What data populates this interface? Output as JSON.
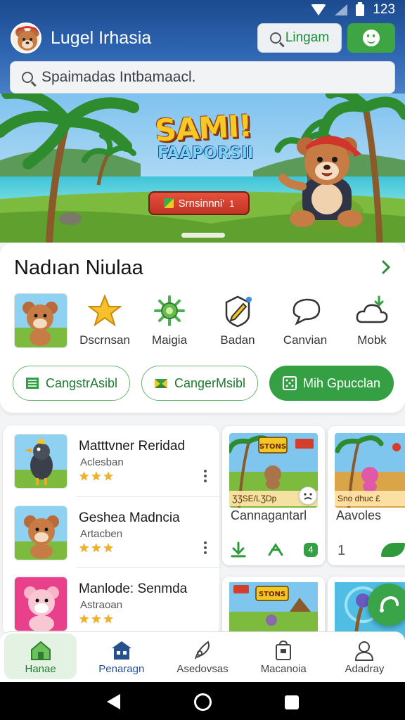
{
  "status_bar": {
    "time": "123"
  },
  "header": {
    "app_title": "Lugel Irhasia",
    "language_button_label": "Lingam",
    "search_placeholder": "Spaimadas Intbamaacl."
  },
  "banner": {
    "title_line1": "SAMI!",
    "title_line2": "FAAPORSII",
    "button_label": "Srnsinnni'",
    "button_badge": "1"
  },
  "featured": {
    "title": "Nadıan Niulaa",
    "categories": [
      {
        "label": "Dscrnsan",
        "icon": "star-icon"
      },
      {
        "label": "Maigia",
        "icon": "gear-sun-icon"
      },
      {
        "label": "Badan",
        "icon": "pen-badge-icon"
      },
      {
        "label": "Canvian",
        "icon": "speech-bubble-icon"
      },
      {
        "label": "Mobk",
        "icon": "cloud-download-icon"
      }
    ],
    "pills": [
      {
        "label": "CangstrAsibl",
        "icon": "list-icon"
      },
      {
        "label": "CangerMsibl",
        "icon": "envelope-icon"
      },
      {
        "label": "Mih Gpucclan",
        "icon": "grid-icon"
      }
    ]
  },
  "list": [
    {
      "title": "Matttvner Reridad",
      "subtitle": "Aclesban",
      "stars": "★★★",
      "rating_stars": 3
    },
    {
      "title": "Geshea Madncia",
      "subtitle": "Artacben",
      "stars": "★★★",
      "rating_stars": 3
    },
    {
      "title": "Manlode: Senmda",
      "subtitle": "Astraoan",
      "stars": "★★★",
      "rating_stars": 3
    }
  ],
  "games": [
    {
      "title": "Cannagantarl",
      "strip": "ƷƷSE/LƷDp",
      "badge": "4",
      "thumb_label": "STONS"
    },
    {
      "title": "Aavoles",
      "strip": "Sno dhuc £",
      "badge": "1"
    }
  ],
  "games_row2": [
    {
      "thumb_label": "STONS"
    }
  ],
  "bottom_nav": [
    {
      "label": "Hanae",
      "icon": "home-icon"
    },
    {
      "label": "Penaragn",
      "icon": "store-icon"
    },
    {
      "label": "Asedovsas",
      "icon": "feather-icon"
    },
    {
      "label": "Macanoia",
      "icon": "bag-icon"
    },
    {
      "label": "Adadray",
      "icon": "person-icon"
    }
  ],
  "colors": {
    "primary": "#34a043",
    "header": "#2f67b3",
    "accent_red": "#d43d2c"
  }
}
